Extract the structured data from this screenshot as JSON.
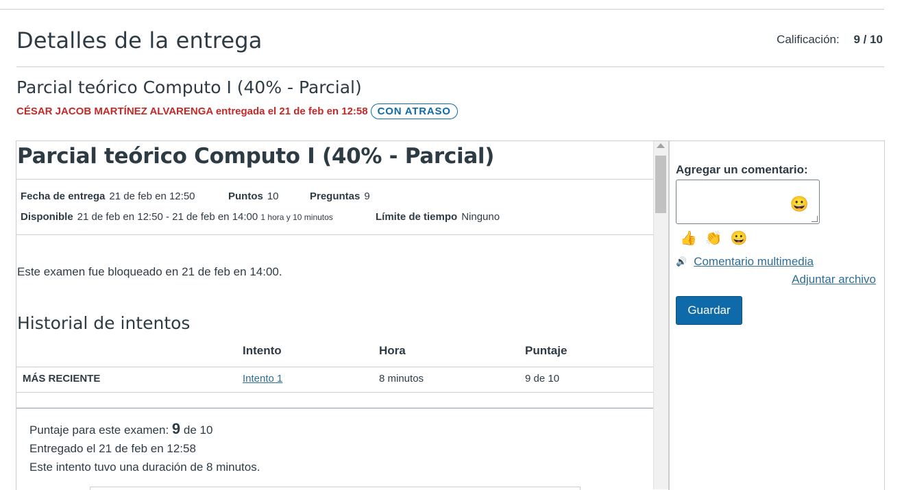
{
  "header": {
    "title": "Detalles de la entrega",
    "grade_label": "Calificación:",
    "grade_value": "9 / 10"
  },
  "assignment": {
    "title": "Parcial teórico Computo I (40% - Parcial)",
    "submitter_line": "CÉSAR JACOB MARTÍNEZ ALVARENGA entregada el 21 de feb en 12:58",
    "late_badge": "CON ATRASO"
  },
  "quiz": {
    "title": "Parcial teórico Computo I (40% - Parcial)",
    "due_label": "Fecha de entrega",
    "due_value": "21 de feb en 12:50",
    "points_label": "Puntos",
    "points_value": "10",
    "questions_label": "Preguntas",
    "questions_value": "9",
    "available_label": "Disponible",
    "available_value": "21 de feb en 12:50 - 21 de feb en 14:00",
    "available_duration": "1 hora y 10 minutos",
    "time_limit_label": "Límite de tiempo",
    "time_limit_value": "Ninguno",
    "locked_text": "Este examen fue bloqueado en 21 de feb en 14:00."
  },
  "history": {
    "title": "Historial de intentos",
    "columns": [
      "",
      "Intento",
      "Hora",
      "Puntaje"
    ],
    "rows": [
      {
        "label": "MÁS RECIENTE",
        "attempt": "Intento 1",
        "time": "8 minutos",
        "score": "9 de 10"
      }
    ]
  },
  "score_summary": {
    "score_prefix": "Puntaje para este examen:",
    "score_value": "9",
    "score_suffix": "de 10",
    "submitted": "Entregado el 21 de feb en 12:58",
    "duration": "Este intento tuvo una duración de 8 minutos."
  },
  "sidebar": {
    "comment_label": "Agregar un comentario:",
    "emoji_picker": "😀",
    "quick_emojis": [
      "👍",
      "👏",
      "😀"
    ],
    "media_icon": "🔊",
    "media_link": "Comentario multimedia",
    "attach_link": "Adjuntar archivo",
    "save_button": "Guardar"
  }
}
